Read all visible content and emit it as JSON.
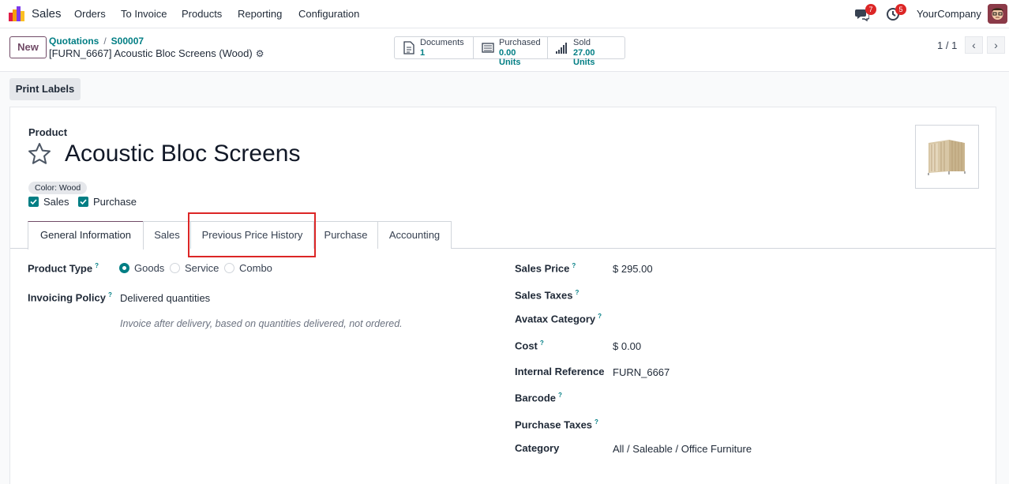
{
  "navbar": {
    "app_name": "Sales",
    "menu": [
      "Orders",
      "To Invoice",
      "Products",
      "Reporting",
      "Configuration"
    ],
    "messages_count": "7",
    "activities_count": "5",
    "company": "YourCompany"
  },
  "control": {
    "new_label": "New",
    "breadcrumb": [
      "Quotations",
      "S00007"
    ],
    "breadcrumb_sep": "/",
    "record_title": "[FURN_6667] Acoustic Bloc Screens (Wood)",
    "smart_buttons": [
      {
        "label": "Documents",
        "value": "1",
        "icon": "document-icon"
      },
      {
        "label": "Purchased",
        "value": "0.00 Units",
        "icon": "cart-icon"
      },
      {
        "label": "Sold",
        "value": "27.00 Units",
        "icon": "signal-bars-icon"
      }
    ],
    "pager": "1 / 1"
  },
  "actions": {
    "print_labels": "Print Labels"
  },
  "product": {
    "label": "Product",
    "name": "Acoustic Bloc Screens",
    "variant_tag": "Color: Wood",
    "checkboxes": [
      {
        "label": "Sales",
        "checked": true
      },
      {
        "label": "Purchase",
        "checked": true
      }
    ]
  },
  "tabs": [
    "General Information",
    "Sales",
    "Previous Price History",
    "Purchase",
    "Accounting"
  ],
  "active_tab": "General Information",
  "highlighted_tab": "Previous Price History",
  "left_fields": {
    "product_type_label": "Product Type",
    "product_type_options": [
      "Goods",
      "Service",
      "Combo"
    ],
    "product_type_selected": "Goods",
    "invoicing_policy_label": "Invoicing Policy",
    "invoicing_policy_value": "Delivered quantities",
    "invoicing_help": "Invoice after delivery, based on quantities delivered, not ordered."
  },
  "right_fields": [
    {
      "label": "Sales Price",
      "help": true,
      "value": "$ 295.00"
    },
    {
      "label": "Sales Taxes",
      "help": true,
      "value": ""
    },
    {
      "label": "Avatax Category",
      "help": true,
      "value": ""
    },
    {
      "label": "Cost",
      "help": true,
      "value": "$ 0.00"
    },
    {
      "label": "Internal Reference",
      "help": false,
      "value": "FURN_6667"
    },
    {
      "label": "Barcode",
      "help": true,
      "value": ""
    },
    {
      "label": "Purchase Taxes",
      "help": true,
      "value": ""
    },
    {
      "label": "Category",
      "help": false,
      "value": "All / Saleable / Office Furniture"
    }
  ],
  "help_mark": "?",
  "colors": {
    "brand": "#714b67",
    "teal": "#017e84",
    "highlight": "#dc2626"
  }
}
